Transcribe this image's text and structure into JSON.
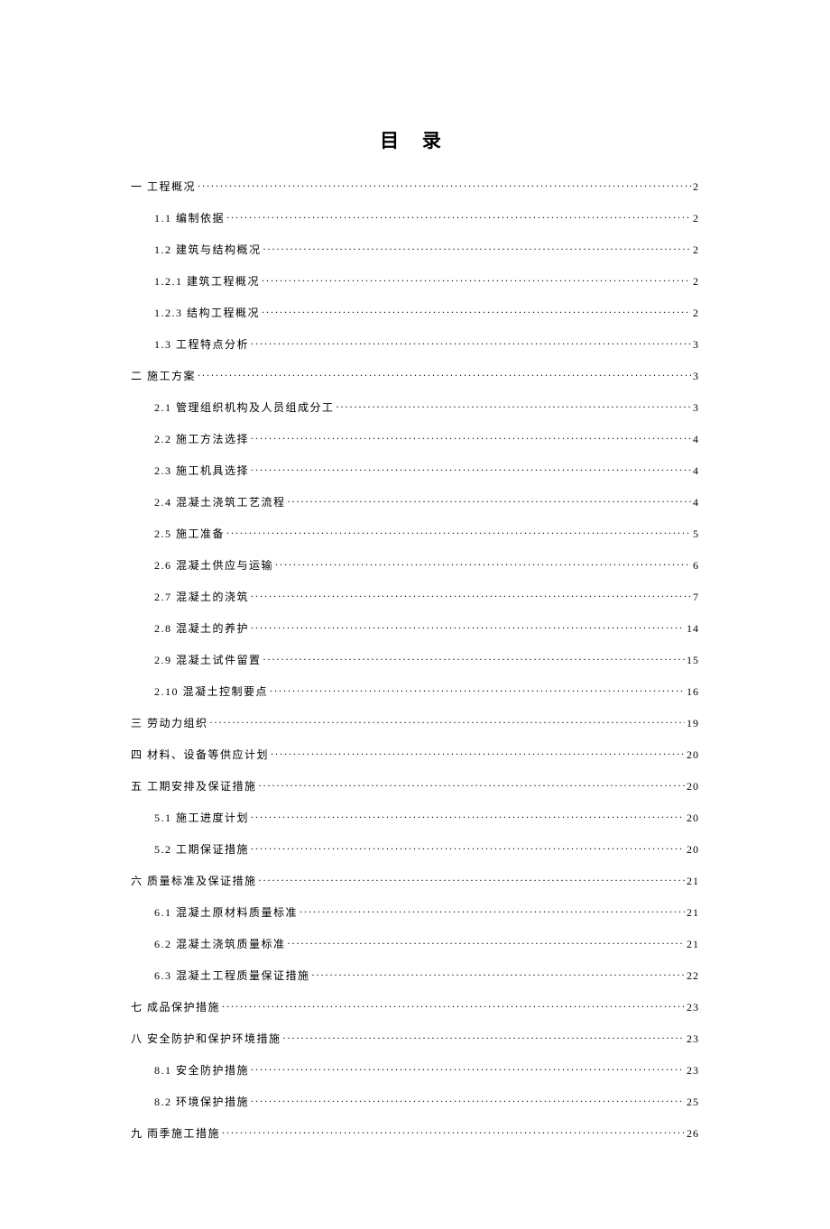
{
  "title": "目 录",
  "toc": [
    {
      "level": 0,
      "text": "一 工程概况",
      "page": "2"
    },
    {
      "level": 1,
      "text": "1.1 编制依据",
      "page": "2"
    },
    {
      "level": 1,
      "text": "1.2 建筑与结构概况",
      "page": "2"
    },
    {
      "level": 1,
      "text": "1.2.1 建筑工程概况",
      "page": "2"
    },
    {
      "level": 1,
      "text": "1.2.3 结构工程概况",
      "page": "2"
    },
    {
      "level": 1,
      "text": "1.3 工程特点分析",
      "page": "3"
    },
    {
      "level": 0,
      "text": "二 施工方案",
      "page": "3"
    },
    {
      "level": 1,
      "text": "2.1 管理组织机构及人员组成分工",
      "page": "3"
    },
    {
      "level": 1,
      "text": "2.2 施工方法选择",
      "page": "4"
    },
    {
      "level": 1,
      "text": "2.3 施工机具选择",
      "page": "4"
    },
    {
      "level": 1,
      "text": "2.4 混凝土浇筑工艺流程",
      "page": "4"
    },
    {
      "level": 1,
      "text": "2.5 施工准备",
      "page": "5"
    },
    {
      "level": 1,
      "text": "2.6 混凝土供应与运输",
      "page": "6"
    },
    {
      "level": 1,
      "text": "2.7 混凝土的浇筑",
      "page": "7"
    },
    {
      "level": 1,
      "text": "2.8 混凝土的养护",
      "page": "14"
    },
    {
      "level": 1,
      "text": "2.9 混凝土试件留置",
      "page": "15"
    },
    {
      "level": 1,
      "text": "2.10 混凝土控制要点",
      "page": "16"
    },
    {
      "level": 0,
      "text": "三 劳动力组织",
      "page": "19"
    },
    {
      "level": 0,
      "text": "四 材料、设备等供应计划",
      "page": "20"
    },
    {
      "level": 0,
      "text": "五 工期安排及保证措施",
      "page": "20"
    },
    {
      "level": 1,
      "text": "5.1 施工进度计划",
      "page": "20"
    },
    {
      "level": 1,
      "text": "5.2 工期保证措施",
      "page": "20"
    },
    {
      "level": 0,
      "text": "六 质量标准及保证措施",
      "page": "21"
    },
    {
      "level": 1,
      "text": "6.1 混凝土原材料质量标准",
      "page": "21"
    },
    {
      "level": 1,
      "text": "6.2 混凝土浇筑质量标准",
      "page": "21"
    },
    {
      "level": 1,
      "text": "6.3 混凝土工程质量保证措施",
      "page": "22"
    },
    {
      "level": 0,
      "text": "七 成品保护措施",
      "page": "23"
    },
    {
      "level": 0,
      "text": "八 安全防护和保护环境措施",
      "page": "23"
    },
    {
      "level": 1,
      "text": "8.1 安全防护措施",
      "page": "23"
    },
    {
      "level": 1,
      "text": "8.2 环境保护措施",
      "page": "25"
    },
    {
      "level": 0,
      "text": "九 雨季施工措施",
      "page": "26"
    }
  ]
}
